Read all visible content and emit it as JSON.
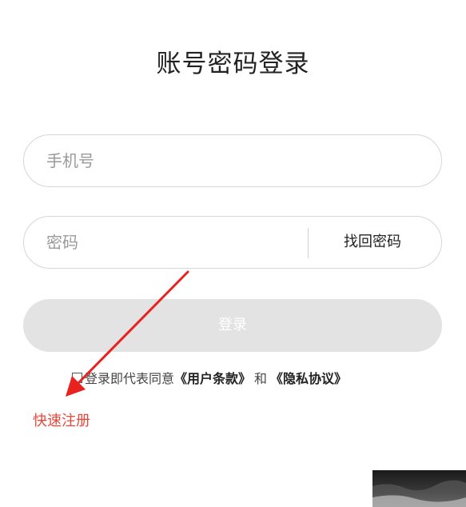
{
  "header": {
    "title": "账号密码登录"
  },
  "form": {
    "phone_placeholder": "手机号",
    "password_placeholder": "密码",
    "forgot_password": "找回密码",
    "login_button": "登录"
  },
  "agreement": {
    "prefix": "登录即代表同意",
    "user_terms": "《用户条款》",
    "and": "和",
    "privacy_policy": "《隐私协议》"
  },
  "register_link": "快速注册",
  "colors": {
    "accent_red": "#e8473a",
    "button_disabled": "#e3e3e3",
    "annotation_arrow": "#e8231f"
  }
}
